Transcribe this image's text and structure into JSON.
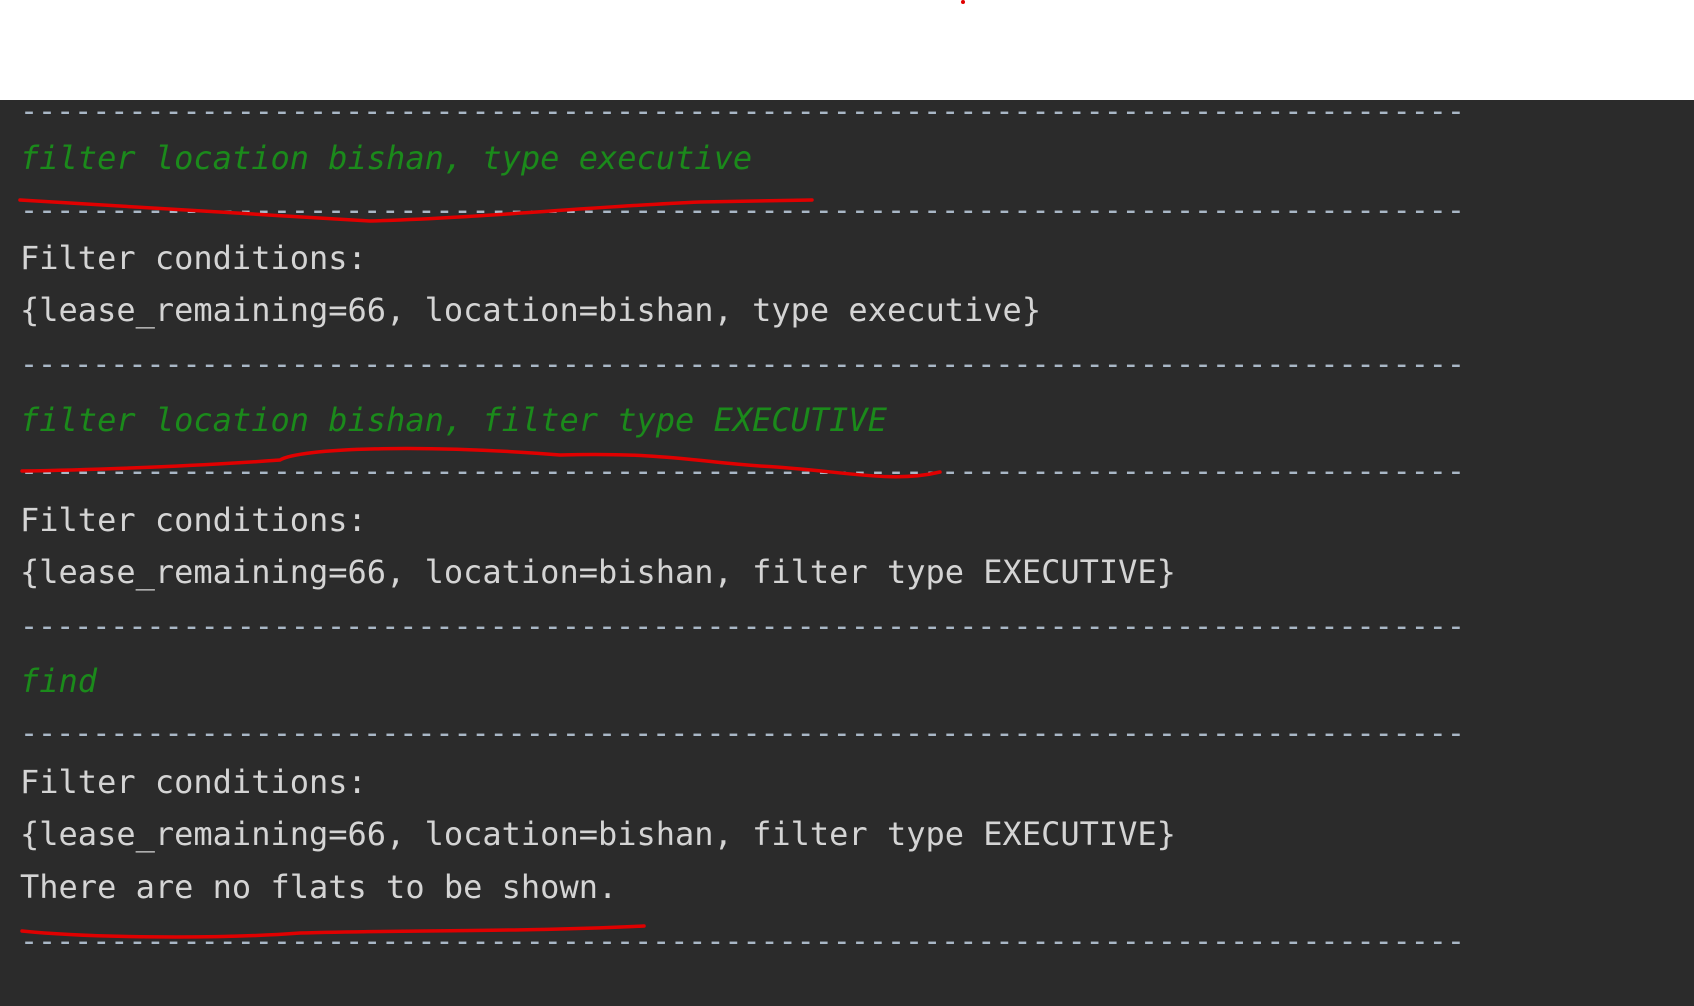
{
  "console": {
    "separator": "--------------------------------------------------------------------------------",
    "blocks": [
      {
        "command": "filter location bishan, type executive"
      },
      {
        "label": "Filter conditions:",
        "conditions": "{lease_remaining=66, location=bishan, type executive}"
      },
      {
        "command": "filter location bishan, filter type EXECUTIVE"
      },
      {
        "label": "Filter conditions:",
        "conditions": "{lease_remaining=66, location=bishan, filter type EXECUTIVE}"
      },
      {
        "command": "find"
      },
      {
        "label": "Filter conditions:",
        "conditions": "{lease_remaining=66, location=bishan, filter type EXECUTIVE}",
        "message": "There are no flats to be shown."
      }
    ]
  },
  "colors": {
    "background": "#2b2b2b",
    "command_text": "#1b8a1b",
    "output_text": "#d4d4d4",
    "annotation": "#e00000"
  }
}
